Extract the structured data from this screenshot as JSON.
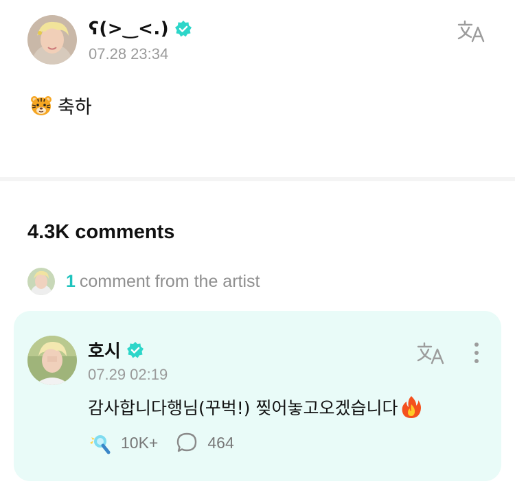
{
  "post": {
    "author_name": "ʕ(>‿<.)",
    "avatar_icon": "user-avatar",
    "verified_icon": "verified-badge-icon",
    "timestamp": "07.28 23:34",
    "translate_icon": "translate-icon",
    "body_emoji": "tiger-face-emoji",
    "body_text": "축하"
  },
  "comments": {
    "title": "4.3K comments",
    "artist_summary": {
      "count": "1",
      "text": "comment from the artist"
    }
  },
  "artist_comment": {
    "author_name": "호시",
    "timestamp": "07.29 02:19",
    "text": "감사합니다행님(꾸벅!) 찢어놓고오겠습니다",
    "trailing_emoji": "fire-emoji",
    "reactions": {
      "icon": "light-stick-icon",
      "count": "10K+"
    },
    "replies": {
      "icon": "speech-bubble-icon",
      "count": "464"
    }
  },
  "colors": {
    "accent": "#1ec3bd",
    "verified": "#2dd6c9",
    "card_background": "#e9fbf8",
    "muted_text": "#9a9a9a"
  }
}
